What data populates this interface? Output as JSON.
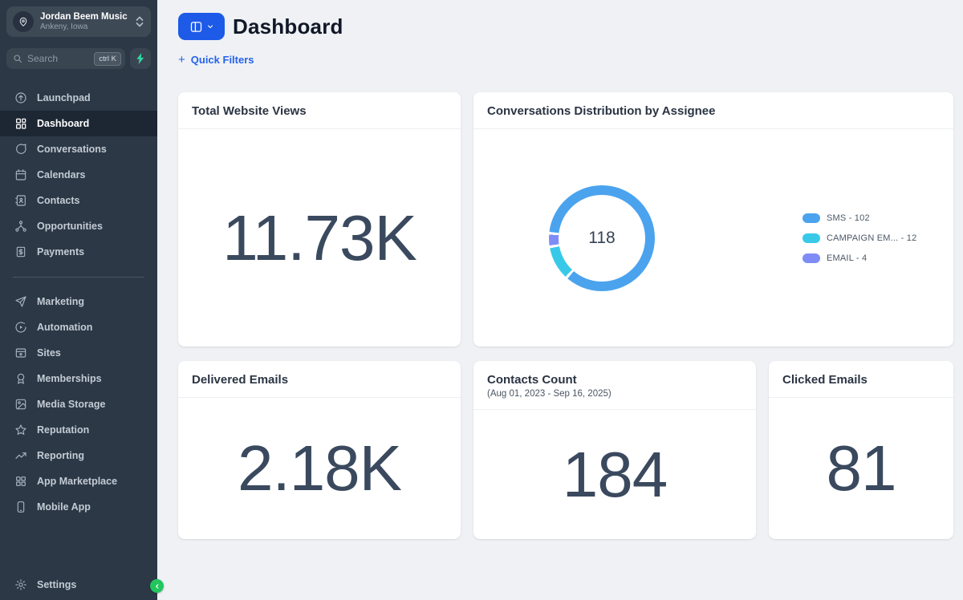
{
  "sidebar": {
    "account": {
      "name": "Jordan Beem Music",
      "location": "Ankeny, Iowa"
    },
    "search": {
      "placeholder": "Search",
      "shortcut": "ctrl K"
    },
    "nav1": [
      {
        "label": "Launchpad"
      },
      {
        "label": "Dashboard"
      },
      {
        "label": "Conversations"
      },
      {
        "label": "Calendars"
      },
      {
        "label": "Contacts"
      },
      {
        "label": "Opportunities"
      },
      {
        "label": "Payments"
      }
    ],
    "nav2": [
      {
        "label": "Marketing"
      },
      {
        "label": "Automation"
      },
      {
        "label": "Sites"
      },
      {
        "label": "Memberships"
      },
      {
        "label": "Media Storage"
      },
      {
        "label": "Reputation"
      },
      {
        "label": "Reporting"
      },
      {
        "label": "App Marketplace"
      },
      {
        "label": "Mobile App"
      }
    ],
    "settings_label": "Settings"
  },
  "header": {
    "title": "Dashboard",
    "quick_filters_plus": "+",
    "quick_filters": "Quick Filters"
  },
  "cards": {
    "total_website_views": {
      "title": "Total Website Views",
      "value": "11.73K"
    },
    "conversations": {
      "title": "Conversations Distribution by Assignee"
    },
    "delivered_emails": {
      "title": "Delivered Emails",
      "value": "2.18K"
    },
    "contacts_count": {
      "title": "Contacts Count",
      "subtitle": "(Aug 01, 2023 - Sep 16, 2025)",
      "value": "184"
    },
    "clicked_emails": {
      "title": "Clicked Emails",
      "value": "81"
    }
  },
  "chart_data": {
    "type": "pie",
    "variant": "donut",
    "title": "Conversations Distribution by Assignee",
    "center_label": "118",
    "total": 118,
    "legend_position": "right",
    "series": [
      {
        "name": "SMS",
        "value": 102,
        "color": "#4ba3ee",
        "label": "SMS - 102"
      },
      {
        "name": "CAMPAIGN EM...",
        "value": 12,
        "color": "#38c9e9",
        "label": "CAMPAIGN EM... - 12"
      },
      {
        "name": "EMAIL",
        "value": 4,
        "color": "#7f8cf6",
        "label": "EMAIL - 4"
      }
    ]
  },
  "colors": {
    "accent_blue": "#1d5ae8",
    "link_blue": "#2563eb",
    "sidebar_bg": "#2c3846",
    "collapse_green": "#22c55e",
    "bolt_teal": "#2fd6a0",
    "number_slate": "#3a495e"
  }
}
